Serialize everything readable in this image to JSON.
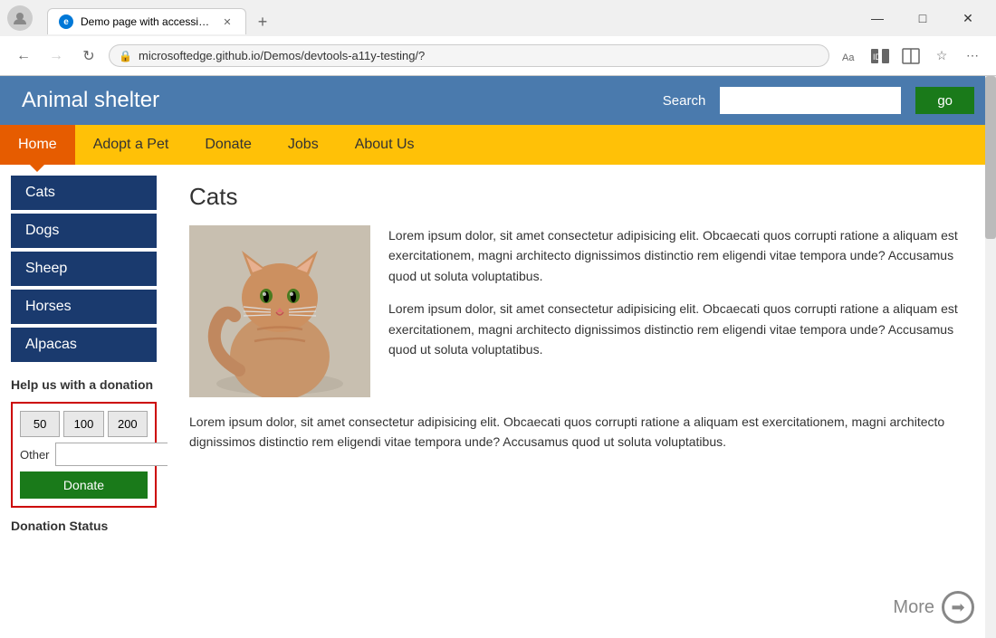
{
  "browser": {
    "tab_title": "Demo page with accessibility issu",
    "url": "microsoftedge.github.io/Demos/devtools-a11y-testing/?",
    "back_btn": "←",
    "forward_btn": "→",
    "refresh_btn": "↻",
    "search_icon": "🔍",
    "minimize": "—",
    "maximize": "□",
    "close": "✕",
    "more_options": "⋯",
    "new_tab": "+",
    "read_aloud": "Aa",
    "immersive": "ID",
    "split_screen": "⊡",
    "favorites": "☆"
  },
  "site": {
    "title": "Animal shelter",
    "search_label": "Search",
    "search_placeholder": "",
    "search_btn": "go"
  },
  "nav": {
    "items": [
      {
        "label": "Home",
        "active": true
      },
      {
        "label": "Adopt a Pet",
        "active": false
      },
      {
        "label": "Donate",
        "active": false
      },
      {
        "label": "Jobs",
        "active": false
      },
      {
        "label": "About Us",
        "active": false
      }
    ]
  },
  "sidebar": {
    "animals": [
      {
        "label": "Cats"
      },
      {
        "label": "Dogs"
      },
      {
        "label": "Sheep"
      },
      {
        "label": "Horses"
      },
      {
        "label": "Alpacas"
      }
    ],
    "donation": {
      "title": "Help us with a donation",
      "amounts": [
        "50",
        "100",
        "200"
      ],
      "other_label": "Other",
      "donate_btn": "Donate",
      "status_title": "Donation Status"
    }
  },
  "article": {
    "title": "Cats",
    "paragraphs": [
      "Lorem ipsum dolor, sit amet consectetur adipisicing elit. Obcaecati quos corrupti ratione a aliquam est exercitationem, magni architecto dignissimos distinctio rem eligendi vitae tempora unde? Accusamus quod ut soluta voluptatibus.",
      "Lorem ipsum dolor, sit amet consectetur adipisicing elit. Obcaecati quos corrupti ratione a aliquam est exercitationem, magni architecto dignissimos distinctio rem eligendi vitae tempora unde? Accusamus quod ut soluta voluptatibus.",
      "Lorem ipsum dolor, sit amet consectetur adipisicing elit. Obcaecati quos corrupti ratione a aliquam est exercitationem, magni architecto dignissimos distinctio rem eligendi vitae tempora unde? Accusamus quod ut soluta voluptatibus."
    ],
    "more_label": "More"
  }
}
